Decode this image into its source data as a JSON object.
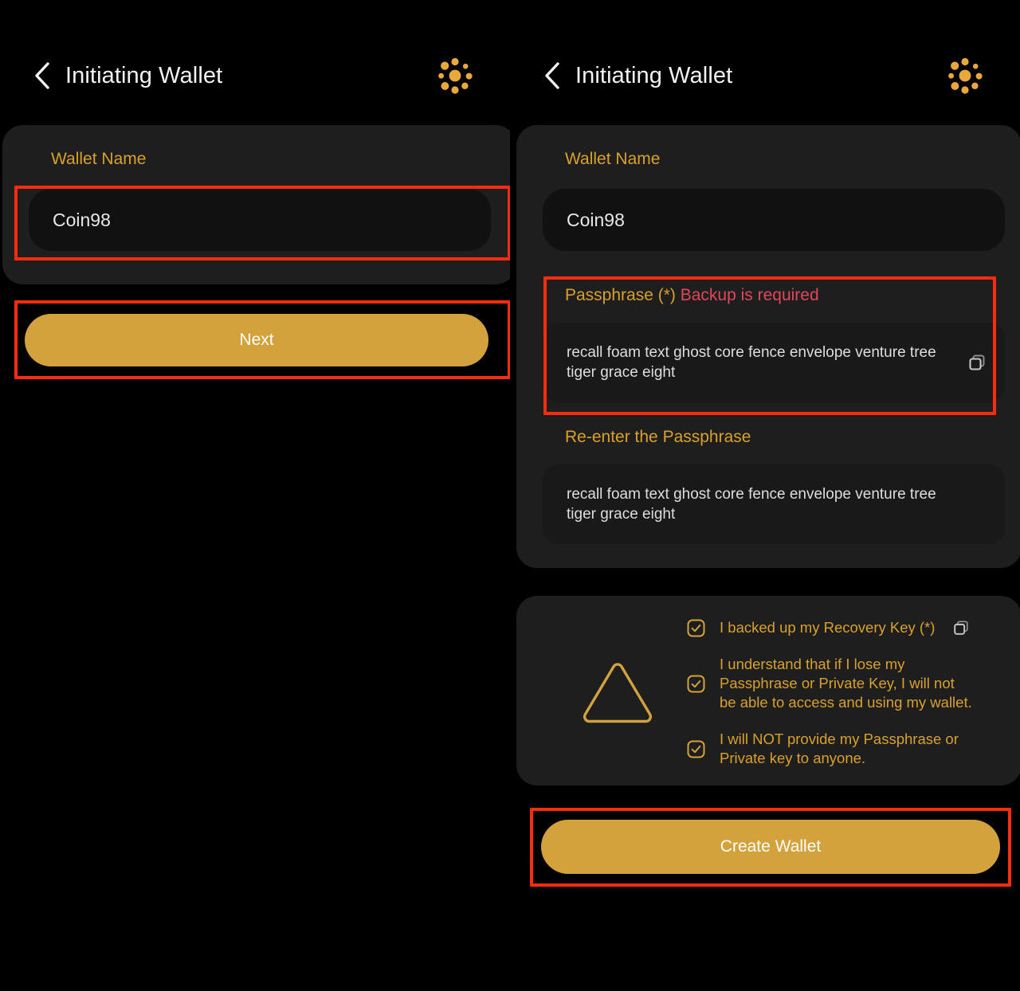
{
  "header": {
    "title": "Initiating Wallet",
    "back_icon": "chevron-left-icon",
    "brand_icon": "coin98-logo-icon"
  },
  "colors": {
    "background": "#000000",
    "card": "#1e1e1e",
    "input": "#111111",
    "input_alt": "#191919",
    "accent_gold": "#d4a23c",
    "label_gold": "#d9a12c",
    "warning_red": "#e0475a",
    "annotation_red": "#fa2b0e",
    "text_primary": "#e8e8e8"
  },
  "left_panel": {
    "wallet_name": {
      "label": "Wallet Name",
      "value": "Coin98",
      "placeholder": "Wallet Name"
    },
    "next_button": {
      "label": "Next"
    }
  },
  "right_panel": {
    "wallet_name": {
      "label": "Wallet Name",
      "value": "Coin98",
      "placeholder": "Wallet Name"
    },
    "passphrase": {
      "label": "Passphrase (*)",
      "warning": "Backup is required",
      "value": "recall foam text ghost core fence envelope venture tree tiger grace eight",
      "placeholder": "Passphrase",
      "copy_icon": "copy-icon"
    },
    "reenter_passphrase": {
      "label": "Re-enter the Passphrase",
      "value": "recall foam text ghost core fence envelope venture tree tiger grace eight",
      "placeholder": "Re-enter the Passphrase"
    },
    "terms": {
      "warning_icon": "warning-triangle-icon",
      "items": [
        {
          "text": "I backed up my Recovery Key (*)",
          "checked": true,
          "check_icon": "checkbox-checked-icon",
          "has_copy": true,
          "copy_icon": "copy-icon"
        },
        {
          "text": "I understand that if I lose my Passphrase or Private Key, I will not be able to access and using my wallet.",
          "checked": true,
          "check_icon": "checkbox-checked-icon",
          "has_copy": false
        },
        {
          "text": "I will NOT provide my Passphrase or Private key to anyone.",
          "checked": true,
          "check_icon": "checkbox-checked-icon",
          "has_copy": false
        }
      ]
    },
    "create_button": {
      "label": "Create Wallet"
    }
  }
}
